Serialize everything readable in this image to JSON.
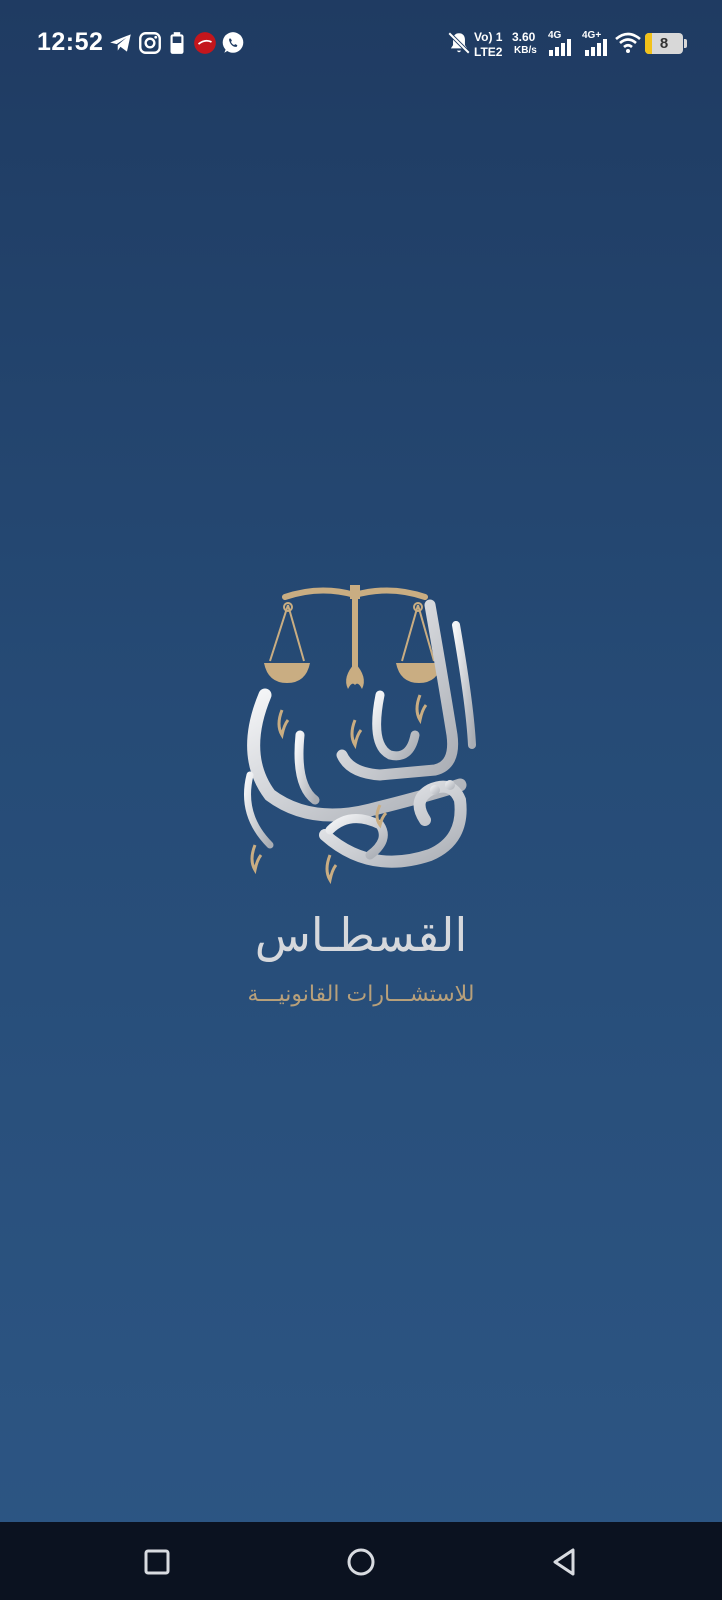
{
  "status_bar": {
    "time": "12:52",
    "volte_line1": "Vo) 1",
    "volte_line2": "LTE2",
    "net_speed_value": "3.60",
    "net_speed_unit": "KB/s",
    "sim1_label": "4G",
    "sim2_label": "4G+",
    "battery_level": "8",
    "left_icons": [
      "telegram-icon",
      "instagram-icon",
      "battery-saver-icon",
      "app-notification-icon",
      "whatsapp-icon"
    ],
    "right_icons": [
      "bell-muted-icon",
      "signal-bars-icon",
      "signal-bars-icon",
      "wifi-icon",
      "battery-icon"
    ]
  },
  "splash": {
    "brand_name": "القسطـاس",
    "tagline": "للاستشـــارات القانونيـــة",
    "logo_icon": "scales-of-justice-calligraphy-logo",
    "colors": {
      "background_top": "#1f3b62",
      "background_bottom": "#2d5684",
      "gold": "#c9ad82",
      "silver": "#d6d8dc"
    }
  },
  "nav_bar": {
    "buttons": [
      "recent-apps-icon",
      "home-icon",
      "back-icon"
    ]
  }
}
